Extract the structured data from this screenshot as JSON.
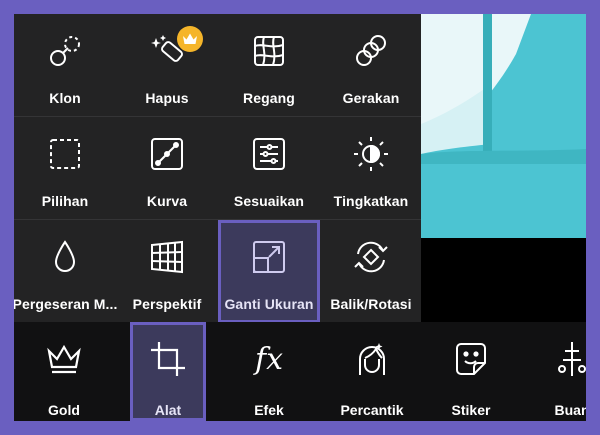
{
  "colors": {
    "accent": "#6a5fc0",
    "menu_bg": "#232324",
    "bar_bg": "#111112",
    "preview": "#4cc4d2",
    "crown": "#f5b52a"
  },
  "tools": [
    {
      "label": "Klon",
      "icon": "clone-icon"
    },
    {
      "label": "Hapus",
      "icon": "eraser-magic-icon",
      "premium": true
    },
    {
      "label": "Regang",
      "icon": "warp-grid-icon"
    },
    {
      "label": "Gerakan",
      "icon": "motion-circles-icon"
    },
    {
      "label": "Pilihan",
      "icon": "selection-dashed-icon"
    },
    {
      "label": "Kurva",
      "icon": "curves-icon"
    },
    {
      "label": "Sesuaikan",
      "icon": "adjust-sliders-icon"
    },
    {
      "label": "Tingkatkan",
      "icon": "enhance-contrast-icon"
    },
    {
      "label": "Pergeseran M...",
      "icon": "water-drop-icon"
    },
    {
      "label": "Perspektif",
      "icon": "perspective-grid-icon"
    },
    {
      "label": "Ganti Ukuran",
      "icon": "resize-icon",
      "selected": true
    },
    {
      "label": "Balik/Rotasi",
      "icon": "flip-rotate-icon"
    }
  ],
  "bottom_tabs": [
    {
      "label": "Gold",
      "icon": "crown-icon"
    },
    {
      "label": "Alat",
      "icon": "crop-icon",
      "selected": true
    },
    {
      "label": "Efek",
      "icon": "fx-icon",
      "glyph": "fx"
    },
    {
      "label": "Percantik",
      "icon": "face-icon"
    },
    {
      "label": "Stiker",
      "icon": "sticker-icon"
    },
    {
      "label": "Buan",
      "icon": "brush-icon"
    }
  ]
}
